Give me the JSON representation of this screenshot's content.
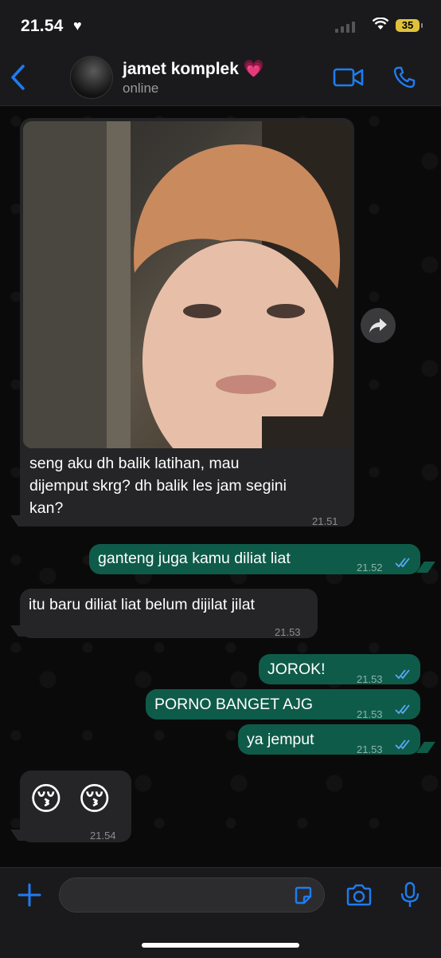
{
  "status_bar": {
    "time": "21.54",
    "battery": "35"
  },
  "header": {
    "contact_name": "jamet komplek 💗",
    "contact_status": "online"
  },
  "messages": [
    {
      "text_line1": "seng aku dh balik latihan, mau",
      "text_line2": "dijemput skrg? dh balik les jam segini",
      "text_line3": "kan?",
      "time": "21.51"
    },
    {
      "text": "ganteng juga kamu diliat liat",
      "time": "21.52"
    },
    {
      "text": "itu baru diliat liat belum dijilat jilat",
      "time": "21.53"
    },
    {
      "text": "JOROK!",
      "time": "21.53"
    },
    {
      "text": "PORNO BANGET AJG",
      "time": "21.53"
    },
    {
      "text": "ya jemput",
      "time": "21.53"
    },
    {
      "text": "😚 😚",
      "time": "21.54"
    }
  ],
  "composer": {
    "placeholder": ""
  },
  "colors": {
    "accent": "#1f7cf0",
    "outgoing": "#0f5b49",
    "incoming": "#252527",
    "read_ticks": "#58a9f5"
  }
}
